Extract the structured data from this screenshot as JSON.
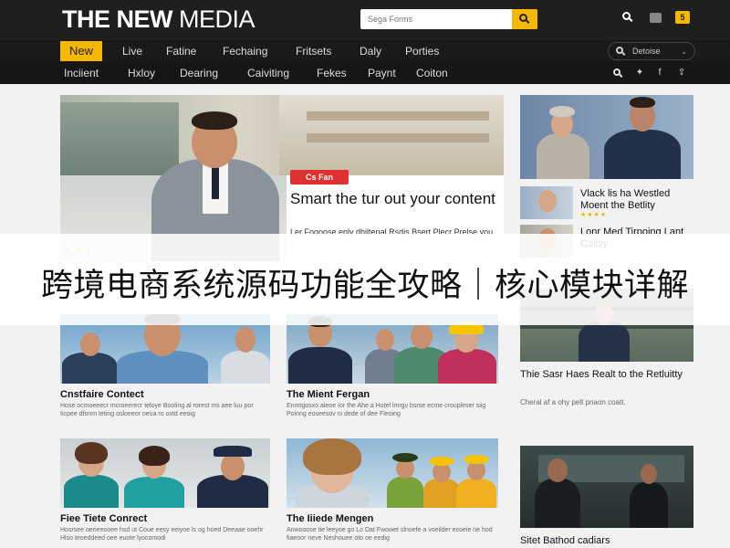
{
  "header": {
    "logo_bold": "THE NEW",
    "logo_light": "MEDIA",
    "search_placeholder": "Sega Forms",
    "badge": "5"
  },
  "nav_primary": {
    "items": [
      {
        "label": "New",
        "active": true
      },
      {
        "label": "Live",
        "active": false
      },
      {
        "label": "Fatine",
        "active": false
      },
      {
        "label": "Fechaing",
        "active": false
      },
      {
        "label": "Fritsets",
        "active": false
      },
      {
        "label": "Daly",
        "active": false
      },
      {
        "label": "Porties",
        "active": false
      }
    ],
    "select_value": "Detoise"
  },
  "nav_secondary": {
    "items": [
      "Inciient",
      "Hxloy",
      "Dearing",
      "Caiviting",
      "Fekes",
      "Paynt",
      "Coiton"
    ]
  },
  "hero": {
    "tag": "Cs Fan",
    "title": "Smart the tur out your content",
    "description": "Ler Foqoose enly dhiltenal Rsdis Bsert Plecr Prelse you."
  },
  "cards": [
    {
      "title": "Cnstfaire Contect",
      "text": "Hose ocmoeeecr mcroeerecr teloye Booling al rorest ms aee luu por ticpee dfonm teting osloeeor oeua ro oxtd eeoig"
    },
    {
      "title": "The Mient Fergan",
      "text": "Enmtgosxo aleoe Ior the Ahe a Hotel lmrgv bsrse ecme croupleser siig Poinng eoseesov ni dede of dee Fleoing"
    },
    {
      "title": "Fiee Tiete Conrect",
      "text": "Hosrsee oerieeooee hsd ut Coue eesy eeiyoe ls og hoed Deeaae ooehr Hlso teoeddeed oee euote lyocomodi"
    },
    {
      "title": "The Iiiede Mengen",
      "text": "Anwooose tie leeyoe go Lo Dat Fwowet slnoefe a voeilder ecoeie ne hod fiaeoor neve Neshouee oto oe eedig"
    }
  ],
  "sidebar": [
    {
      "title": "Vlack lis ha Westled Moent the Betlity",
      "stars": "★★★★"
    },
    {
      "title": "Lonr Med Tirpoing Lant Calitiy",
      "stars": ""
    },
    {
      "title": "Thie Sasr Haes Realt to the Retluitty",
      "text": "Cheral af a ohy pelt pnaon coatt."
    },
    {
      "title": "Sitet Bathod cadiars",
      "text": ""
    }
  ],
  "banner": {
    "text": "跨境电商系统源码功能全攻略｜核心模块详解"
  }
}
